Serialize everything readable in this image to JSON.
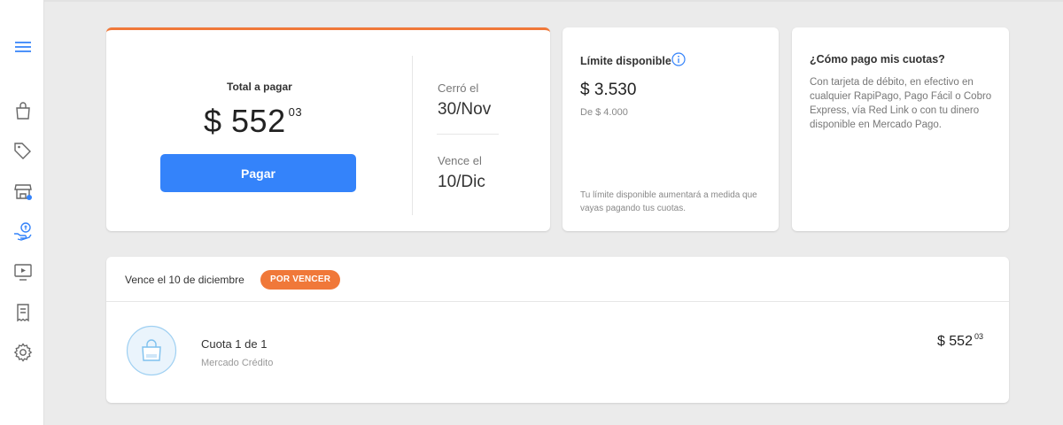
{
  "sidebar": {
    "icons": [
      "menu-icon",
      "shopping-bag-icon",
      "tag-icon",
      "store-icon",
      "money-hand-icon",
      "video-icon",
      "receipt-icon",
      "gear-icon"
    ],
    "active_color": "#3483fa"
  },
  "summary": {
    "total_label": "Total a pagar",
    "total_integer": "$ 552",
    "total_cents": "03",
    "pay_label": "Pagar",
    "closed_label": "Cerró el",
    "closed_date": "30/Nov",
    "due_label": "Vence el",
    "due_date": "10/Dic"
  },
  "limit": {
    "title": "Límite disponible",
    "amount": "$ 3.530",
    "of_total": "De $ 4.000",
    "note": "Tu límite disponible aumentará a medida que vayas pagando tus cuotas."
  },
  "how_to_pay": {
    "title": "¿Cómo pago mis cuotas?",
    "text": "Con tarjeta de débito, en efectivo en cualquier RapiPago, Pago Fácil o Cobro Express, vía Red Link o con tu dinero disponible en Mercado Pago."
  },
  "installment": {
    "due_text": "Vence el 10 de diciembre",
    "badge": "POR VENCER",
    "name": "Cuota 1 de 1",
    "lender": "Mercado Crédito",
    "amount_integer": "$ 552",
    "amount_cents": "03"
  },
  "colors": {
    "accent": "#3483fa",
    "orange": "#f07839",
    "background": "#ebebeb"
  }
}
